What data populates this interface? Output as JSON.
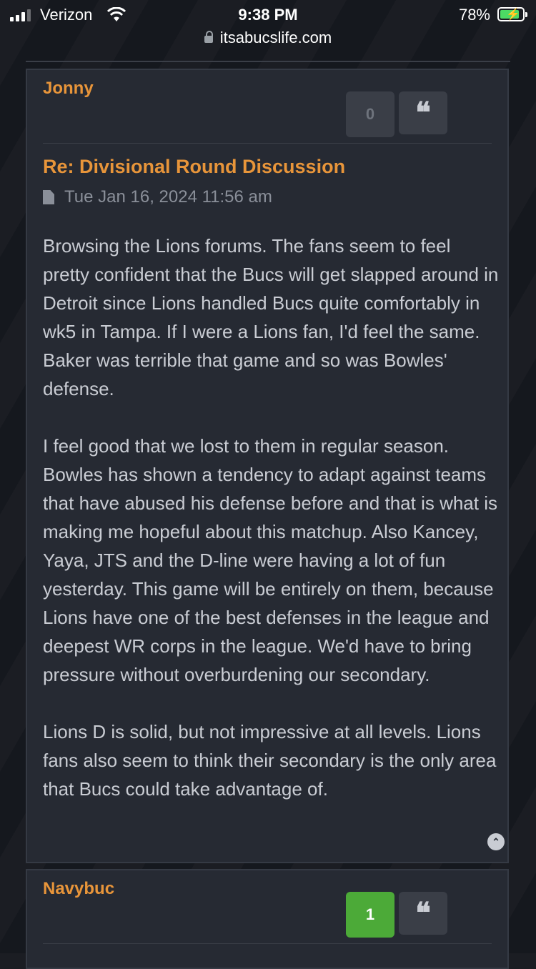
{
  "status_bar": {
    "carrier": "Verizon",
    "time": "9:38 PM",
    "battery": "78%",
    "url": "itsabucslife.com",
    "icons": [
      "signal-icon",
      "wifi-icon",
      "lock-icon",
      "battery-charging-icon"
    ]
  },
  "post1": {
    "author": "Jonny",
    "like_count": "0",
    "quote_icon": "❝",
    "title": "Re: Divisional Round Discussion",
    "date": "Tue Jan 16, 2024 11:56 am",
    "paragraphs": [
      "Browsing the Lions forums. The fans seem to feel pretty confident that the Bucs will get slapped around in Detroit since Lions handled Bucs quite comfortably in wk5 in Tampa. If I were a Lions fan, I'd feel the same. Baker was terrible that game and so was Bowles' defense.",
      "I feel good that we lost to them in regular season. Bowles has shown a tendency to adapt against teams that have abused his defense before and that is what is making me hopeful about this matchup. Also Kancey, Yaya, JTS and the D-line were having a lot of fun yesterday. This game will be entirely on them, because Lions have one of the best defenses in the league and deepest WR corps in the league. We'd have to bring pressure without overburdening our secondary.",
      "Lions D is solid, but not impressive at all levels. Lions fans also seem to think their secondary is the only area that Bucs could take advantage of."
    ],
    "scroll_top_icon": "⌃"
  },
  "post2": {
    "author": "Navybuc",
    "like_count": "1",
    "quote_icon": "❝"
  },
  "colors": {
    "accent": "#e8953a",
    "card_bg": "#262a33",
    "like_active": "#4caa38"
  }
}
